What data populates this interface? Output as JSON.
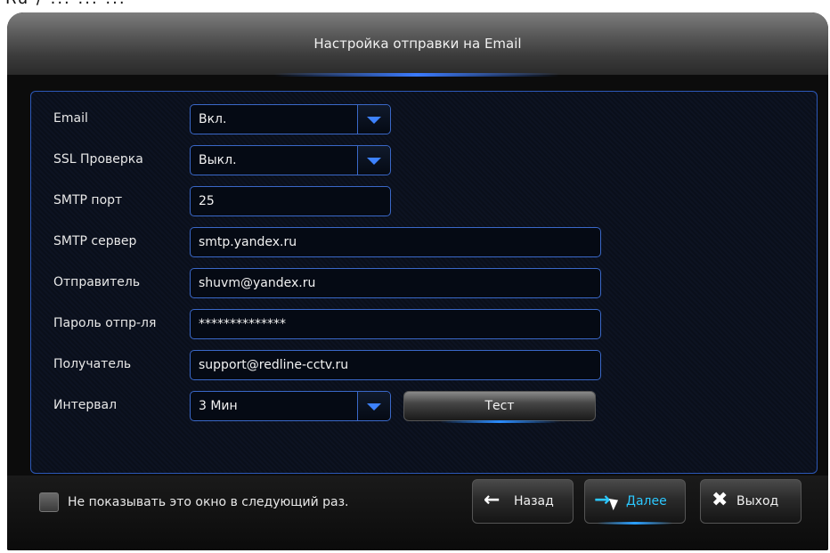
{
  "window": {
    "title": "Настройка отправки на Email"
  },
  "form": {
    "email": {
      "label": "Email",
      "value": "Вкл."
    },
    "ssl": {
      "label": "SSL Проверка",
      "value": "Выкл."
    },
    "smtp_port": {
      "label": "SMTP порт",
      "value": "25"
    },
    "smtp_server": {
      "label": "SMTP сервер",
      "value": "smtp.yandex.ru"
    },
    "sender": {
      "label": "Отправитель",
      "value": "shuvm@yandex.ru"
    },
    "sender_password": {
      "label": "Пароль отпр-ля",
      "value": "**************"
    },
    "recipient": {
      "label": "Получатель",
      "value": "support@redline-cctv.ru"
    },
    "interval": {
      "label": "Интервал",
      "value": "3 Мин"
    },
    "test_label": "Тест"
  },
  "footer": {
    "dont_show_label": "Не показывать это окно в следующий раз.",
    "back_label": "Назад",
    "next_label": "Далее",
    "exit_label": "Выход"
  },
  "icons": {
    "back": "arrow-left-icon",
    "next": "arrow-right-icon",
    "exit": "close-icon"
  },
  "colors": {
    "accent": "#3b7bff",
    "active_text": "#2cc8ff",
    "border": "#3a68c8"
  }
}
